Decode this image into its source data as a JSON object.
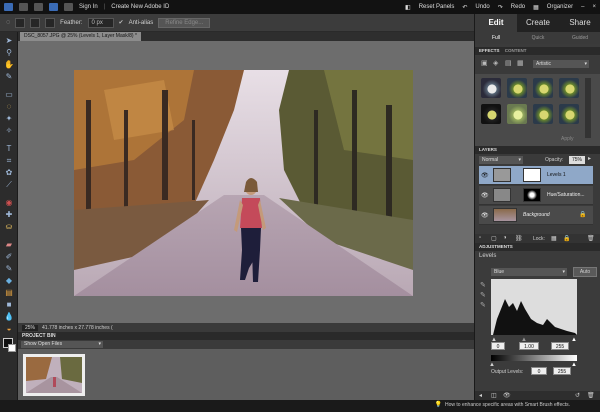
{
  "menubar": {
    "sign_in": "Sign In",
    "create_adobe_id": "Create New Adobe ID",
    "reset_panels": "Reset Panels",
    "undo": "Undo",
    "redo": "Redo",
    "organizer": "Organizer"
  },
  "options": {
    "feather_label": "Feather:",
    "feather_value": "0 px",
    "anti_alias": "Anti-alias",
    "refine_edge": "Refine Edge..."
  },
  "document": {
    "tab_title": "DSC_8057.JPG @ 25% (Levels 1, Layer Mask/8) *",
    "zoom": "25%",
    "dimensions": "41.778 inches x 27.778 inches ("
  },
  "project_bin": {
    "title": "PROJECT BIN",
    "dropdown": "Show Open Files"
  },
  "modes": {
    "tabs": [
      "Edit",
      "Create",
      "Share"
    ],
    "subtabs": [
      "Full",
      "Quick",
      "Guided"
    ]
  },
  "effects": {
    "tabs": [
      "EFFECTS",
      "CONTENT"
    ],
    "category": "Artistic",
    "apply_label": "Apply"
  },
  "layers": {
    "title": "LAYERS",
    "blend_mode": "Normal",
    "opacity_label": "Opacity:",
    "opacity_value": "75%",
    "lock_label": "Lock:",
    "items": [
      {
        "name": "Levels 1"
      },
      {
        "name": "Hue/Saturation..."
      },
      {
        "name": "Background"
      }
    ]
  },
  "adjustments": {
    "title": "ADJUSTMENTS",
    "panel_name": "Levels",
    "channel": "Blue",
    "auto_label": "Auto",
    "input_black": "0",
    "input_gamma": "1.00",
    "input_white": "255",
    "output_label": "Output Levels:",
    "output_black": "0",
    "output_white": "255"
  },
  "hint": "How to enhance specific areas with Smart Brush effects.",
  "colors": {
    "accent_blue": "#3a6bb5",
    "selected_layer": "#8fa8c8"
  }
}
